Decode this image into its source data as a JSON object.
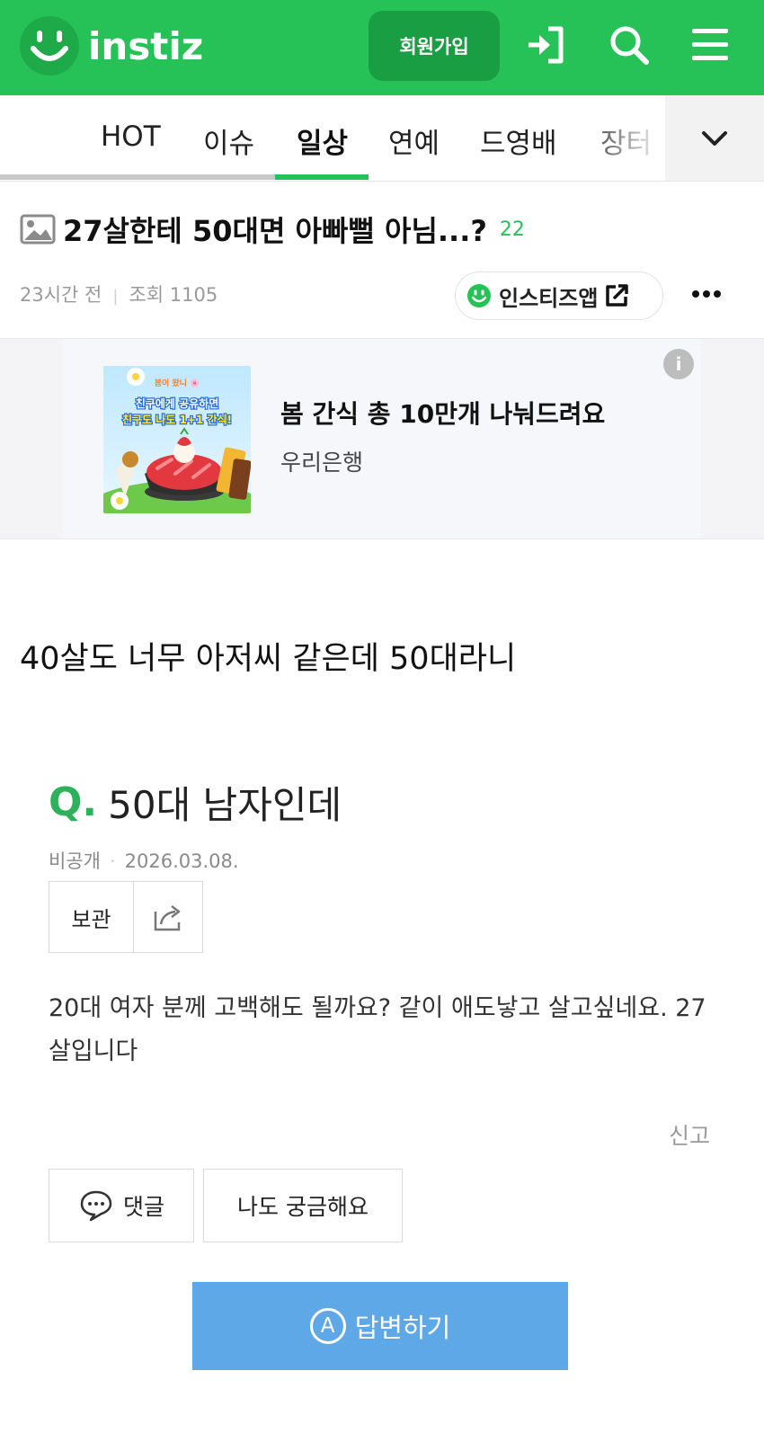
{
  "header": {
    "logo_text": "instiz",
    "join_label": "회원가입",
    "icons": [
      "login-icon",
      "search-icon",
      "menu-icon"
    ],
    "brand_color": "#27c257"
  },
  "nav": {
    "tabs": [
      {
        "label": "HOT"
      },
      {
        "label": "이슈"
      },
      {
        "label": "일상",
        "active": true
      },
      {
        "label": "연예"
      },
      {
        "label": "드영배"
      },
      {
        "label": "장터"
      }
    ],
    "more_icon": "chevron-down-icon"
  },
  "post": {
    "title": "27살한테 50대면 아빠뻘 아님...?",
    "comment_count": "22",
    "time": "23시간 전",
    "views": "조회 1105",
    "app_button": "인스티즈앱"
  },
  "ad": {
    "title": "봄 간식 총 10만개 나눠드려요",
    "sponsor": "우리은행",
    "image_text": {
      "line1": "봄이 왔니 🌸",
      "line2": "친구에게 공유하면",
      "line3": "친구도 나도 1+1 간식!"
    }
  },
  "body": {
    "text": "40살도 너무 아저씨 같은데 50대라니"
  },
  "qa": {
    "q_mark": "Q.",
    "title": "50대 남자인데",
    "author": "비공개",
    "date": "2026.03.08.",
    "keep_label": "보관",
    "content": "20대 여자 분께 고백해도 될까요? 같이 애도낳고 살고싶네요. 27살입니다",
    "report_label": "신고",
    "comment_label": "댓글",
    "curious_label": "나도 궁금해요",
    "answer_badge": "A",
    "answer_label": "답변하기",
    "answer_color": "#5ea8e8"
  }
}
